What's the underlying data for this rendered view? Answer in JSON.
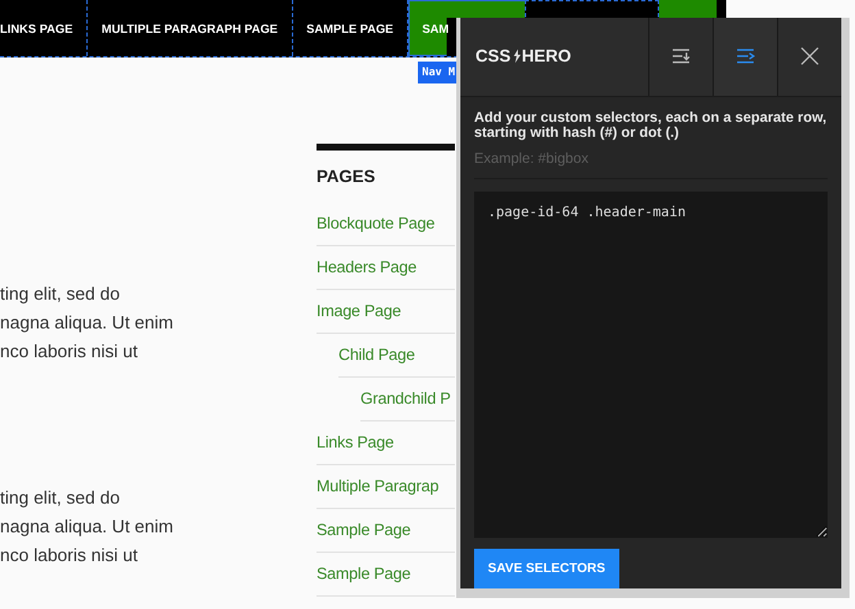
{
  "nav": {
    "items": [
      {
        "label": "LINKS PAGE",
        "highlighted": false
      },
      {
        "label": "MULTIPLE PARAGRAPH PAGE",
        "highlighted": false
      },
      {
        "label": "SAMPLE PAGE",
        "highlighted": false
      },
      {
        "label": "SAM",
        "highlighted": true
      }
    ],
    "selector_label": "Nav M"
  },
  "article": {
    "paragraphs": [
      {
        "lines": [
          "ting elit, sed do",
          "nagna aliqua. Ut enim",
          "nco laboris nisi ut"
        ]
      },
      {
        "lines": [
          "ting elit, sed do",
          "nagna aliqua. Ut enim",
          "nco laboris nisi ut"
        ]
      }
    ]
  },
  "sidebar": {
    "title": "PAGES",
    "items": [
      {
        "label": "Blockquote Page"
      },
      {
        "label": "Headers Page"
      },
      {
        "label": "Image Page",
        "children": [
          {
            "label": "Child Page",
            "children": [
              {
                "label": "Grandchild P"
              }
            ]
          }
        ]
      },
      {
        "label": "Links Page"
      },
      {
        "label": "Multiple Paragrap"
      },
      {
        "label": "Sample Page"
      },
      {
        "label": "Sample Page"
      }
    ]
  },
  "panel": {
    "logo": [
      "CSS",
      "HERO"
    ],
    "tools": [
      {
        "kind": "import",
        "selected": false
      },
      {
        "kind": "add",
        "selected": true
      },
      {
        "kind": "close",
        "selected": false
      }
    ],
    "instructions": "Add your custom selectors, each on a separate row, starting with hash (#) or dot (.)",
    "placeholder": "Example: #bigbox",
    "value": ".page-id-64 .header-main",
    "button": "SAVE SELECTORS"
  }
}
